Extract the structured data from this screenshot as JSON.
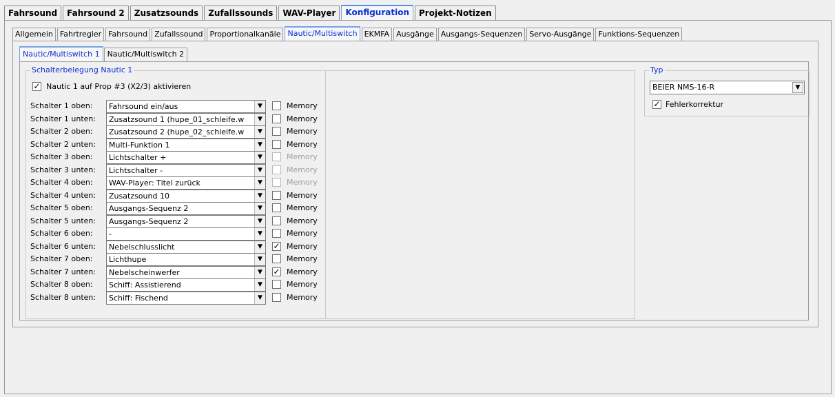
{
  "top_tabs": [
    "Fahrsound",
    "Fahrsound 2",
    "Zusatzsounds",
    "Zufallssounds",
    "WAV-Player",
    "Konfiguration",
    "Projekt-Notizen"
  ],
  "top_active": "Konfiguration",
  "sub_tabs": [
    "Allgemein",
    "Fahrtregler",
    "Fahrsound",
    "Zufallssound",
    "Proportionalkanäle",
    "Nautic/Multiswitch",
    "EKMFA",
    "Ausgänge",
    "Ausgangs-Sequenzen",
    "Servo-Ausgänge",
    "Funktions-Sequenzen"
  ],
  "sub_active": "Nautic/Multiswitch",
  "inner_tabs": [
    "Nautic/Multiswitch 1",
    "Nautic/Multiswitch 2"
  ],
  "inner_active": "Nautic/Multiswitch 1",
  "group_title": "Schalterbelegung Nautic 1",
  "activate_label": "Nautic 1 auf Prop #3 (X2/3) aktivieren",
  "activate_checked": true,
  "memory_label": "Memory",
  "switches": [
    {
      "label": "Schalter 1 oben:",
      "value": "Fahrsound ein/aus",
      "memory": false,
      "enabled": true
    },
    {
      "label": "Schalter 1 unten:",
      "value": "Zusatzsound 1 (hupe_01_schleife.w",
      "memory": false,
      "enabled": true
    },
    {
      "label": "Schalter 2 oben:",
      "value": "Zusatzsound 2 (hupe_02_schleife.w",
      "memory": false,
      "enabled": true
    },
    {
      "label": "Schalter 2 unten:",
      "value": "Multi-Funktion 1",
      "memory": false,
      "enabled": true
    },
    {
      "label": "Schalter 3 oben:",
      "value": "Lichtschalter +",
      "memory": false,
      "enabled": false
    },
    {
      "label": "Schalter 3 unten:",
      "value": "Lichtschalter -",
      "memory": false,
      "enabled": false
    },
    {
      "label": "Schalter 4 oben:",
      "value": "WAV-Player: Titel zurück",
      "memory": false,
      "enabled": false
    },
    {
      "label": "Schalter 4 unten:",
      "value": "Zusatzsound 10",
      "memory": false,
      "enabled": true
    },
    {
      "label": "Schalter 5 oben:",
      "value": "Ausgangs-Sequenz 2",
      "memory": false,
      "enabled": true
    },
    {
      "label": "Schalter 5 unten:",
      "value": "Ausgangs-Sequenz 2",
      "memory": false,
      "enabled": true
    },
    {
      "label": "Schalter 6 oben:",
      "value": "-",
      "memory": false,
      "enabled": true
    },
    {
      "label": "Schalter 6 unten:",
      "value": "Nebelschlusslicht",
      "memory": true,
      "enabled": true
    },
    {
      "label": "Schalter 7 oben:",
      "value": "Lichthupe",
      "memory": false,
      "enabled": true
    },
    {
      "label": "Schalter 7 unten:",
      "value": "Nebelscheinwerfer",
      "memory": true,
      "enabled": true
    },
    {
      "label": "Schalter 8 oben:",
      "value": "Schiff: Assistierend",
      "memory": false,
      "enabled": true
    },
    {
      "label": "Schalter 8 unten:",
      "value": "Schiff: Fischend",
      "memory": false,
      "enabled": true
    }
  ],
  "typ": {
    "title": "Typ",
    "value": "BEIER NMS-16-R",
    "fehlerkorrektur_label": "Fehlerkorrektur",
    "fehlerkorrektur_checked": true
  },
  "colors": {
    "active_tab_text": "#0b2fd0",
    "group_title": "#0b2fd0",
    "disabled_text": "#a0a0a0",
    "background": "#f0f0f0"
  }
}
